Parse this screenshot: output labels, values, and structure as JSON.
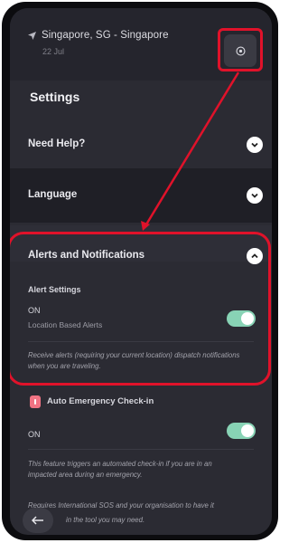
{
  "header": {
    "location": "Singapore, SG - Singapore",
    "time": "22 Jul"
  },
  "page": {
    "title": "Settings"
  },
  "sections": {
    "help": {
      "label": "Need Help?"
    },
    "language": {
      "label": "Language"
    },
    "alerts": {
      "label": "Alerts and Notifications",
      "alert_settings_title": "Alert Settings",
      "on_label": "ON",
      "location_alerts_label": "Location Based Alerts",
      "description": "Receive alerts (requiring your current location) dispatch notifications when you are traveling."
    },
    "auto_checkin": {
      "label": "Auto Emergency Check-in",
      "on_label": "ON",
      "description_1": "This feature triggers an automated check-in if you are in an",
      "description_2": "impacted area during an emergency.",
      "footer_1": "Requires International SOS and your organisation to have it",
      "footer_2": "in the tool you may need."
    }
  },
  "toggles": {
    "location_alerts": true,
    "auto_checkin": true
  },
  "colors": {
    "highlight": "#e0122a",
    "toggle_on": "#88d3b5",
    "background": "#2b2b33"
  }
}
